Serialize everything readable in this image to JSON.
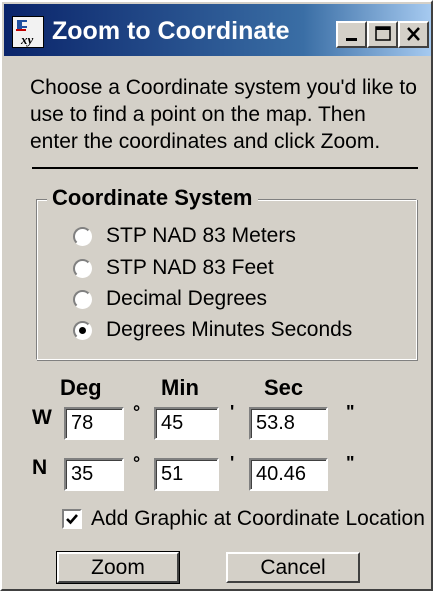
{
  "window": {
    "title": "Zoom to Coordinate",
    "controls": {
      "minimize": "minimize-icon",
      "maximize": "maximize-icon",
      "close": "close-icon"
    }
  },
  "instructions": [
    "Choose a Coordinate system you'd like to",
    "use to find a point on the map.  Then",
    "enter the coordinates and click Zoom."
  ],
  "coordinate_system": {
    "label": "Coordinate System",
    "options": [
      "STP NAD 83 Meters",
      "STP NAD 83 Feet",
      "Decimal Degrees",
      "Degrees Minutes Seconds"
    ],
    "selected": "Degrees Minutes Seconds"
  },
  "columns": {
    "deg": "Deg",
    "min": "Min",
    "sec": "Sec"
  },
  "longitude": {
    "dir": "W",
    "deg": "78",
    "min": "45",
    "sec": "53.8"
  },
  "latitude": {
    "dir": "N",
    "deg": "35",
    "min": "51",
    "sec": "40.46"
  },
  "symbols": {
    "degree": "°",
    "minute": "'",
    "second": "\""
  },
  "add_graphic": {
    "label": "Add Graphic at Coordinate Location",
    "checked": true
  },
  "buttons": {
    "zoom": "Zoom",
    "cancel": "Cancel"
  },
  "colors": {
    "face": "#d4d0c8",
    "title_start": "#0a246a",
    "title_end": "#a6caf0"
  }
}
